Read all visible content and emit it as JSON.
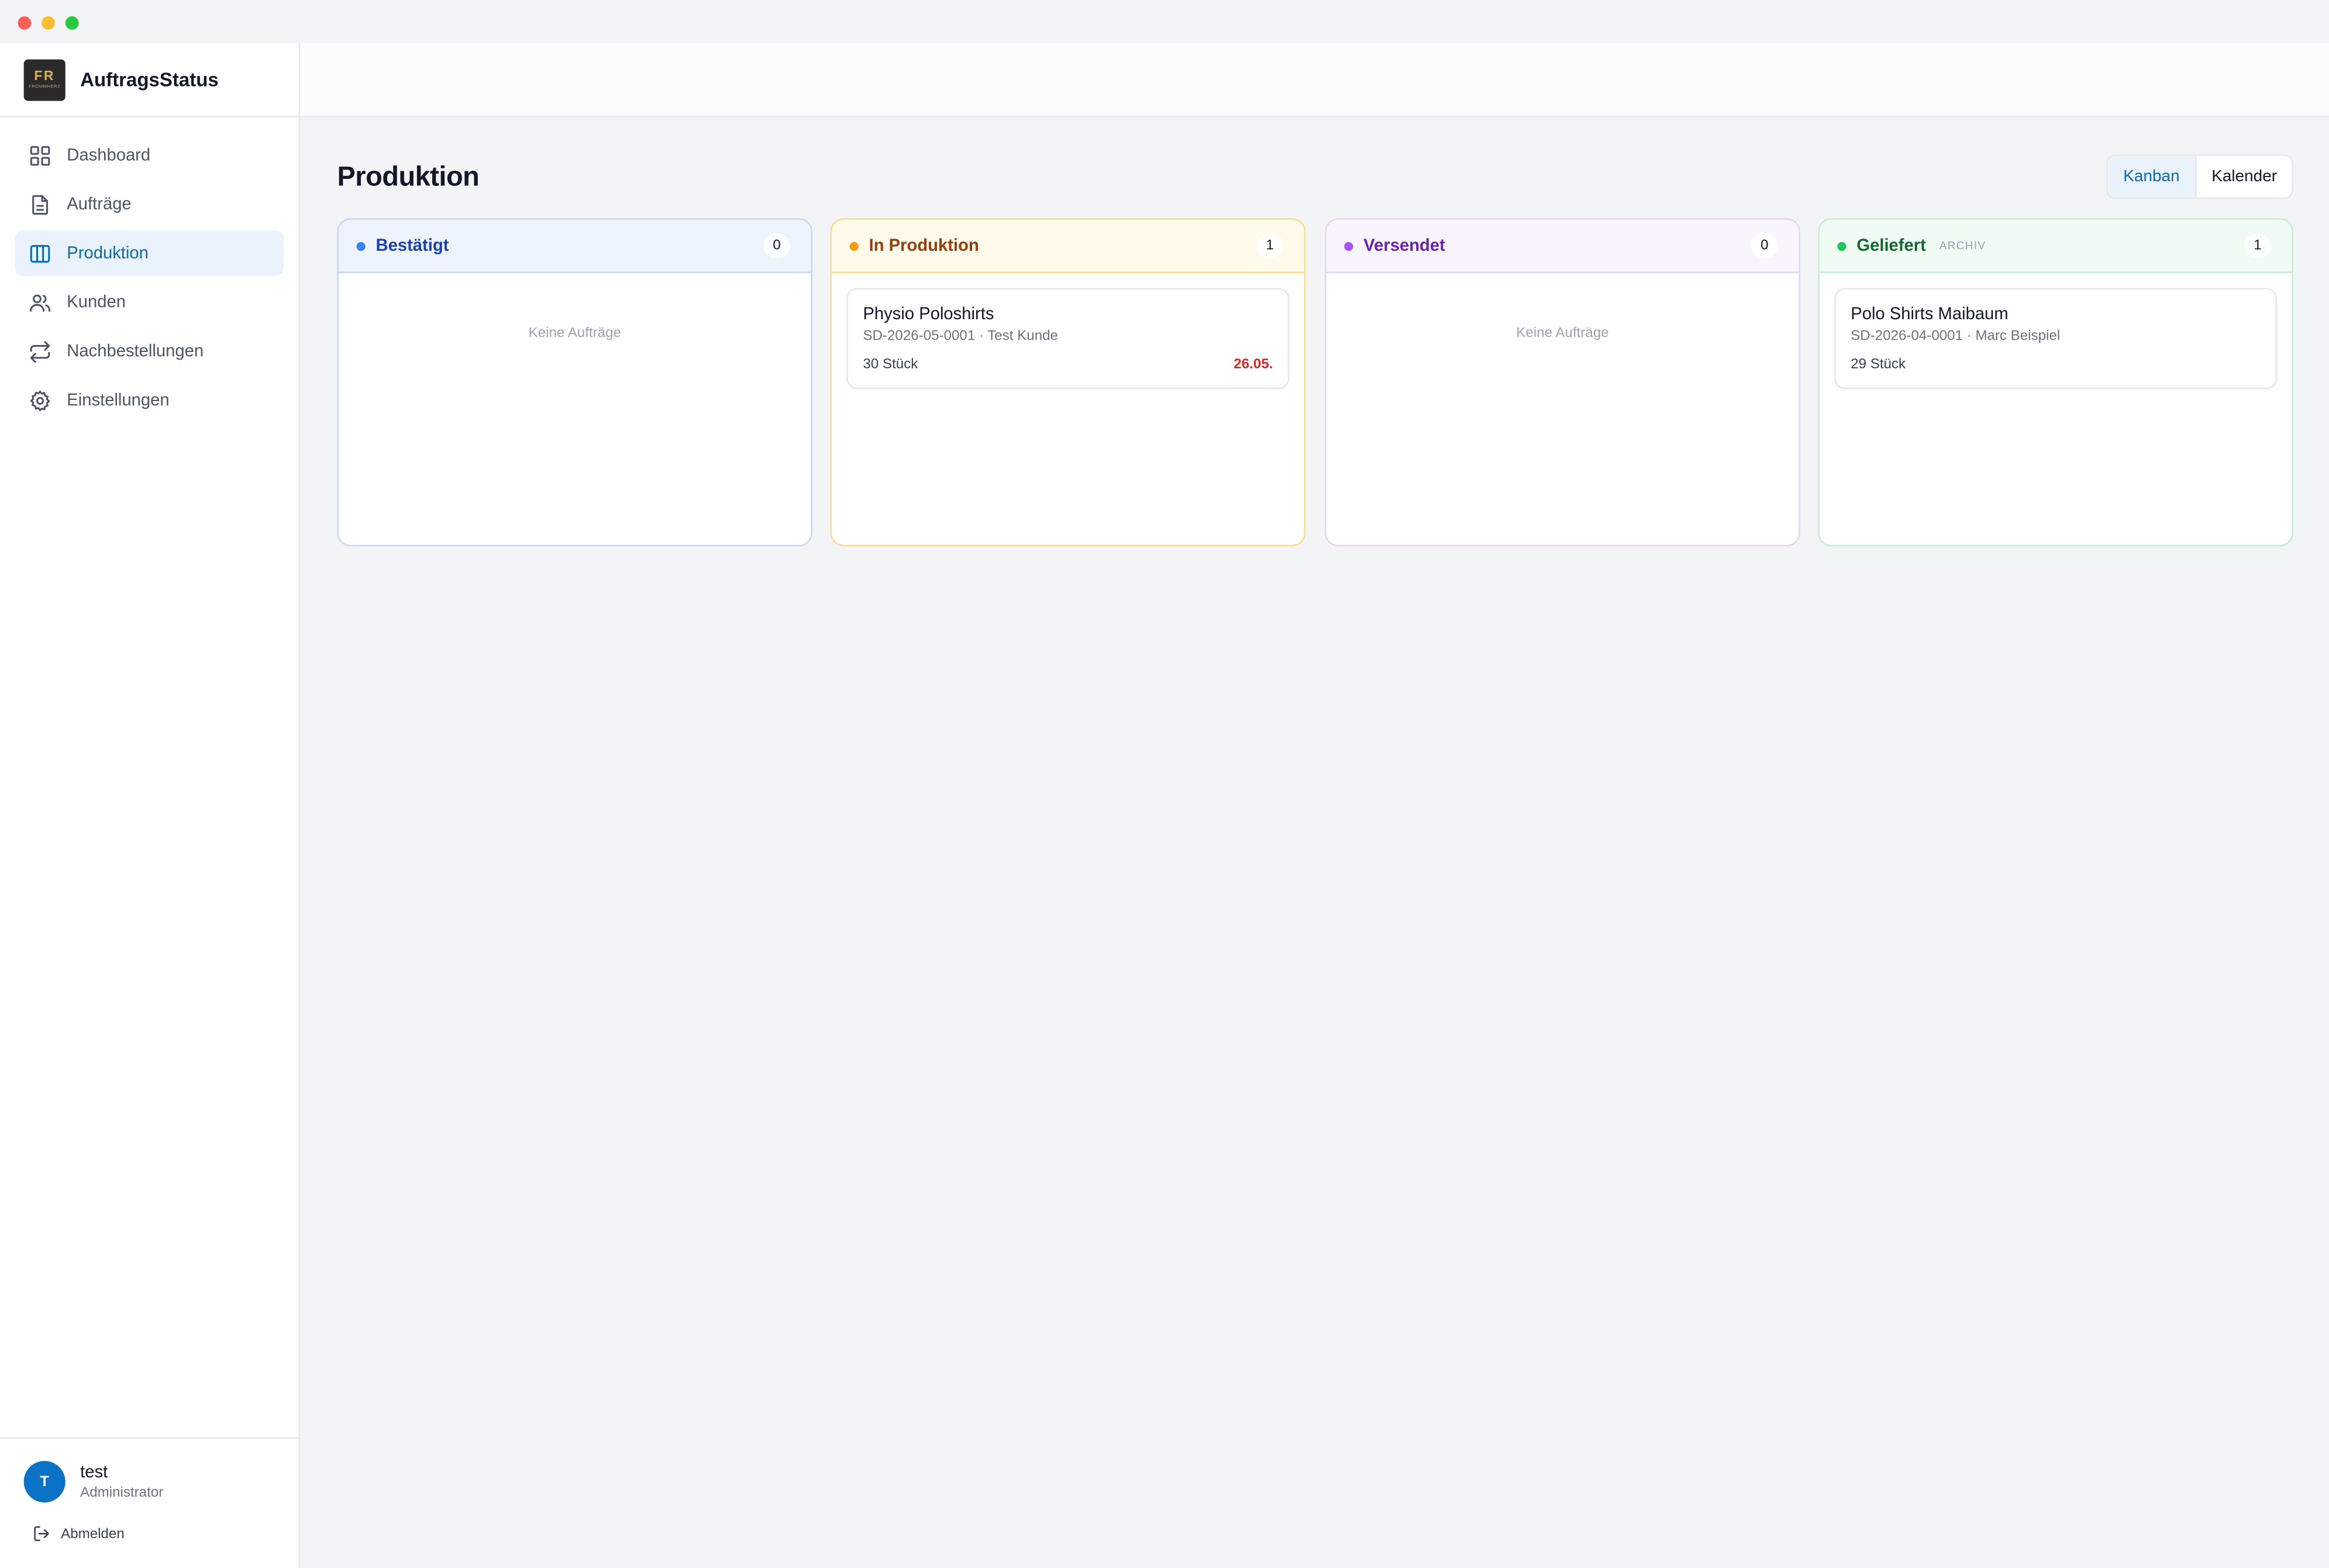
{
  "app": {
    "name": "AuftragsStatus",
    "logo_text": "FR",
    "logo_subtext": "FROMMHERZ"
  },
  "sidebar": {
    "items": [
      {
        "label": "Dashboard",
        "icon": "grid-icon",
        "active": false
      },
      {
        "label": "Aufträge",
        "icon": "document-icon",
        "active": false
      },
      {
        "label": "Produktion",
        "icon": "columns-icon",
        "active": true
      },
      {
        "label": "Kunden",
        "icon": "users-icon",
        "active": false
      },
      {
        "label": "Nachbestellungen",
        "icon": "repeat-icon",
        "active": false
      },
      {
        "label": "Einstellungen",
        "icon": "gear-icon",
        "active": false
      }
    ]
  },
  "user": {
    "initial": "T",
    "name": "test",
    "role": "Administrator",
    "logout_label": "Abmelden"
  },
  "page": {
    "title": "Produktion"
  },
  "view_toggle": {
    "kanban": "Kanban",
    "kalender": "Kalender",
    "selected": "Kanban"
  },
  "columns": [
    {
      "title": "Bestätigt",
      "count": "0",
      "empty_text": "Keine Aufträge",
      "color": "#3b82f6"
    },
    {
      "title": "In Produktion",
      "count": "1",
      "color": "#f59e0b",
      "card": {
        "title": "Physio Poloshirts",
        "meta": "SD-2026-05-0001 · Test Kunde",
        "qty": "30 Stück",
        "date": "26.05."
      }
    },
    {
      "title": "Versendet",
      "count": "0",
      "empty_text": "Keine Aufträge",
      "color": "#a855f7"
    },
    {
      "title": "Geliefert",
      "tag": "ARCHIV",
      "count": "1",
      "color": "#22c55e",
      "card": {
        "title": "Polo Shirts Maibaum",
        "meta": "SD-2026-04-0001 · Marc Beispiel",
        "qty": "29 Stück"
      }
    }
  ],
  "colors": {
    "accent": "#0b6aa8",
    "avatar": "#0b73c6",
    "due_date": "#dc2626"
  }
}
